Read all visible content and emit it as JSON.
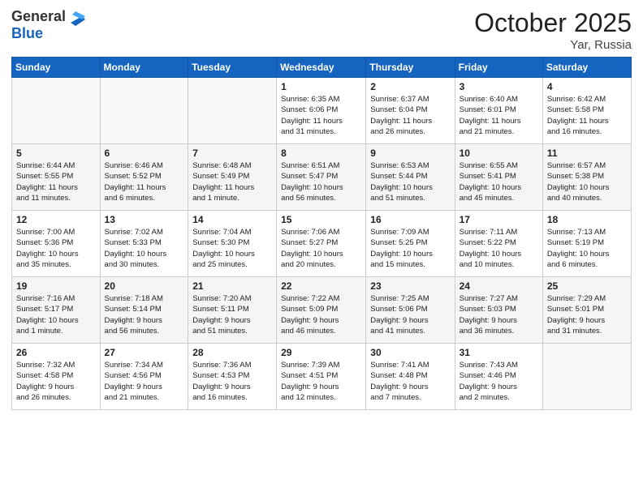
{
  "logo": {
    "general": "General",
    "blue": "Blue"
  },
  "title": "October 2025",
  "location": "Yar, Russia",
  "days_header": [
    "Sunday",
    "Monday",
    "Tuesday",
    "Wednesday",
    "Thursday",
    "Friday",
    "Saturday"
  ],
  "weeks": [
    [
      {
        "day": "",
        "info": ""
      },
      {
        "day": "",
        "info": ""
      },
      {
        "day": "",
        "info": ""
      },
      {
        "day": "1",
        "info": "Sunrise: 6:35 AM\nSunset: 6:06 PM\nDaylight: 11 hours\nand 31 minutes."
      },
      {
        "day": "2",
        "info": "Sunrise: 6:37 AM\nSunset: 6:04 PM\nDaylight: 11 hours\nand 26 minutes."
      },
      {
        "day": "3",
        "info": "Sunrise: 6:40 AM\nSunset: 6:01 PM\nDaylight: 11 hours\nand 21 minutes."
      },
      {
        "day": "4",
        "info": "Sunrise: 6:42 AM\nSunset: 5:58 PM\nDaylight: 11 hours\nand 16 minutes."
      }
    ],
    [
      {
        "day": "5",
        "info": "Sunrise: 6:44 AM\nSunset: 5:55 PM\nDaylight: 11 hours\nand 11 minutes."
      },
      {
        "day": "6",
        "info": "Sunrise: 6:46 AM\nSunset: 5:52 PM\nDaylight: 11 hours\nand 6 minutes."
      },
      {
        "day": "7",
        "info": "Sunrise: 6:48 AM\nSunset: 5:49 PM\nDaylight: 11 hours\nand 1 minute."
      },
      {
        "day": "8",
        "info": "Sunrise: 6:51 AM\nSunset: 5:47 PM\nDaylight: 10 hours\nand 56 minutes."
      },
      {
        "day": "9",
        "info": "Sunrise: 6:53 AM\nSunset: 5:44 PM\nDaylight: 10 hours\nand 51 minutes."
      },
      {
        "day": "10",
        "info": "Sunrise: 6:55 AM\nSunset: 5:41 PM\nDaylight: 10 hours\nand 45 minutes."
      },
      {
        "day": "11",
        "info": "Sunrise: 6:57 AM\nSunset: 5:38 PM\nDaylight: 10 hours\nand 40 minutes."
      }
    ],
    [
      {
        "day": "12",
        "info": "Sunrise: 7:00 AM\nSunset: 5:36 PM\nDaylight: 10 hours\nand 35 minutes."
      },
      {
        "day": "13",
        "info": "Sunrise: 7:02 AM\nSunset: 5:33 PM\nDaylight: 10 hours\nand 30 minutes."
      },
      {
        "day": "14",
        "info": "Sunrise: 7:04 AM\nSunset: 5:30 PM\nDaylight: 10 hours\nand 25 minutes."
      },
      {
        "day": "15",
        "info": "Sunrise: 7:06 AM\nSunset: 5:27 PM\nDaylight: 10 hours\nand 20 minutes."
      },
      {
        "day": "16",
        "info": "Sunrise: 7:09 AM\nSunset: 5:25 PM\nDaylight: 10 hours\nand 15 minutes."
      },
      {
        "day": "17",
        "info": "Sunrise: 7:11 AM\nSunset: 5:22 PM\nDaylight: 10 hours\nand 10 minutes."
      },
      {
        "day": "18",
        "info": "Sunrise: 7:13 AM\nSunset: 5:19 PM\nDaylight: 10 hours\nand 6 minutes."
      }
    ],
    [
      {
        "day": "19",
        "info": "Sunrise: 7:16 AM\nSunset: 5:17 PM\nDaylight: 10 hours\nand 1 minute."
      },
      {
        "day": "20",
        "info": "Sunrise: 7:18 AM\nSunset: 5:14 PM\nDaylight: 9 hours\nand 56 minutes."
      },
      {
        "day": "21",
        "info": "Sunrise: 7:20 AM\nSunset: 5:11 PM\nDaylight: 9 hours\nand 51 minutes."
      },
      {
        "day": "22",
        "info": "Sunrise: 7:22 AM\nSunset: 5:09 PM\nDaylight: 9 hours\nand 46 minutes."
      },
      {
        "day": "23",
        "info": "Sunrise: 7:25 AM\nSunset: 5:06 PM\nDaylight: 9 hours\nand 41 minutes."
      },
      {
        "day": "24",
        "info": "Sunrise: 7:27 AM\nSunset: 5:03 PM\nDaylight: 9 hours\nand 36 minutes."
      },
      {
        "day": "25",
        "info": "Sunrise: 7:29 AM\nSunset: 5:01 PM\nDaylight: 9 hours\nand 31 minutes."
      }
    ],
    [
      {
        "day": "26",
        "info": "Sunrise: 7:32 AM\nSunset: 4:58 PM\nDaylight: 9 hours\nand 26 minutes."
      },
      {
        "day": "27",
        "info": "Sunrise: 7:34 AM\nSunset: 4:56 PM\nDaylight: 9 hours\nand 21 minutes."
      },
      {
        "day": "28",
        "info": "Sunrise: 7:36 AM\nSunset: 4:53 PM\nDaylight: 9 hours\nand 16 minutes."
      },
      {
        "day": "29",
        "info": "Sunrise: 7:39 AM\nSunset: 4:51 PM\nDaylight: 9 hours\nand 12 minutes."
      },
      {
        "day": "30",
        "info": "Sunrise: 7:41 AM\nSunset: 4:48 PM\nDaylight: 9 hours\nand 7 minutes."
      },
      {
        "day": "31",
        "info": "Sunrise: 7:43 AM\nSunset: 4:46 PM\nDaylight: 9 hours\nand 2 minutes."
      },
      {
        "day": "",
        "info": ""
      }
    ]
  ]
}
